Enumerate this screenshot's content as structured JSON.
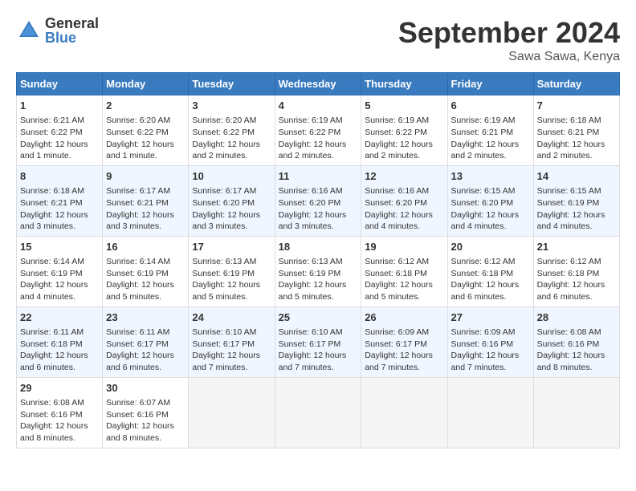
{
  "logo": {
    "name": "General",
    "name2": "Blue"
  },
  "title": "September 2024",
  "location": "Sawa Sawa, Kenya",
  "days_of_week": [
    "Sunday",
    "Monday",
    "Tuesday",
    "Wednesday",
    "Thursday",
    "Friday",
    "Saturday"
  ],
  "weeks": [
    [
      {
        "day": "1",
        "sunrise": "6:21 AM",
        "sunset": "6:22 PM",
        "daylight": "12 hours and 1 minute."
      },
      {
        "day": "2",
        "sunrise": "6:20 AM",
        "sunset": "6:22 PM",
        "daylight": "12 hours and 1 minute."
      },
      {
        "day": "3",
        "sunrise": "6:20 AM",
        "sunset": "6:22 PM",
        "daylight": "12 hours and 2 minutes."
      },
      {
        "day": "4",
        "sunrise": "6:19 AM",
        "sunset": "6:22 PM",
        "daylight": "12 hours and 2 minutes."
      },
      {
        "day": "5",
        "sunrise": "6:19 AM",
        "sunset": "6:22 PM",
        "daylight": "12 hours and 2 minutes."
      },
      {
        "day": "6",
        "sunrise": "6:19 AM",
        "sunset": "6:21 PM",
        "daylight": "12 hours and 2 minutes."
      },
      {
        "day": "7",
        "sunrise": "6:18 AM",
        "sunset": "6:21 PM",
        "daylight": "12 hours and 2 minutes."
      }
    ],
    [
      {
        "day": "8",
        "sunrise": "6:18 AM",
        "sunset": "6:21 PM",
        "daylight": "12 hours and 3 minutes."
      },
      {
        "day": "9",
        "sunrise": "6:17 AM",
        "sunset": "6:21 PM",
        "daylight": "12 hours and 3 minutes."
      },
      {
        "day": "10",
        "sunrise": "6:17 AM",
        "sunset": "6:20 PM",
        "daylight": "12 hours and 3 minutes."
      },
      {
        "day": "11",
        "sunrise": "6:16 AM",
        "sunset": "6:20 PM",
        "daylight": "12 hours and 3 minutes."
      },
      {
        "day": "12",
        "sunrise": "6:16 AM",
        "sunset": "6:20 PM",
        "daylight": "12 hours and 4 minutes."
      },
      {
        "day": "13",
        "sunrise": "6:15 AM",
        "sunset": "6:20 PM",
        "daylight": "12 hours and 4 minutes."
      },
      {
        "day": "14",
        "sunrise": "6:15 AM",
        "sunset": "6:19 PM",
        "daylight": "12 hours and 4 minutes."
      }
    ],
    [
      {
        "day": "15",
        "sunrise": "6:14 AM",
        "sunset": "6:19 PM",
        "daylight": "12 hours and 4 minutes."
      },
      {
        "day": "16",
        "sunrise": "6:14 AM",
        "sunset": "6:19 PM",
        "daylight": "12 hours and 5 minutes."
      },
      {
        "day": "17",
        "sunrise": "6:13 AM",
        "sunset": "6:19 PM",
        "daylight": "12 hours and 5 minutes."
      },
      {
        "day": "18",
        "sunrise": "6:13 AM",
        "sunset": "6:19 PM",
        "daylight": "12 hours and 5 minutes."
      },
      {
        "day": "19",
        "sunrise": "6:12 AM",
        "sunset": "6:18 PM",
        "daylight": "12 hours and 5 minutes."
      },
      {
        "day": "20",
        "sunrise": "6:12 AM",
        "sunset": "6:18 PM",
        "daylight": "12 hours and 6 minutes."
      },
      {
        "day": "21",
        "sunrise": "6:12 AM",
        "sunset": "6:18 PM",
        "daylight": "12 hours and 6 minutes."
      }
    ],
    [
      {
        "day": "22",
        "sunrise": "6:11 AM",
        "sunset": "6:18 PM",
        "daylight": "12 hours and 6 minutes."
      },
      {
        "day": "23",
        "sunrise": "6:11 AM",
        "sunset": "6:17 PM",
        "daylight": "12 hours and 6 minutes."
      },
      {
        "day": "24",
        "sunrise": "6:10 AM",
        "sunset": "6:17 PM",
        "daylight": "12 hours and 7 minutes."
      },
      {
        "day": "25",
        "sunrise": "6:10 AM",
        "sunset": "6:17 PM",
        "daylight": "12 hours and 7 minutes."
      },
      {
        "day": "26",
        "sunrise": "6:09 AM",
        "sunset": "6:17 PM",
        "daylight": "12 hours and 7 minutes."
      },
      {
        "day": "27",
        "sunrise": "6:09 AM",
        "sunset": "6:16 PM",
        "daylight": "12 hours and 7 minutes."
      },
      {
        "day": "28",
        "sunrise": "6:08 AM",
        "sunset": "6:16 PM",
        "daylight": "12 hours and 8 minutes."
      }
    ],
    [
      {
        "day": "29",
        "sunrise": "6:08 AM",
        "sunset": "6:16 PM",
        "daylight": "12 hours and 8 minutes."
      },
      {
        "day": "30",
        "sunrise": "6:07 AM",
        "sunset": "6:16 PM",
        "daylight": "12 hours and 8 minutes."
      },
      {
        "day": "",
        "sunrise": "",
        "sunset": "",
        "daylight": ""
      },
      {
        "day": "",
        "sunrise": "",
        "sunset": "",
        "daylight": ""
      },
      {
        "day": "",
        "sunrise": "",
        "sunset": "",
        "daylight": ""
      },
      {
        "day": "",
        "sunrise": "",
        "sunset": "",
        "daylight": ""
      },
      {
        "day": "",
        "sunrise": "",
        "sunset": "",
        "daylight": ""
      }
    ]
  ]
}
